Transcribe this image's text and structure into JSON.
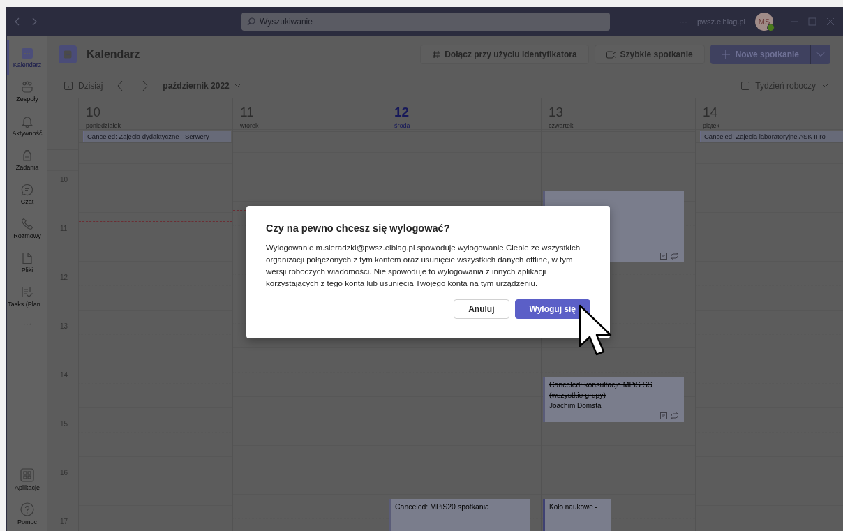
{
  "titlebar": {
    "search": {
      "placeholder": "Wyszukiwanie"
    },
    "more": "···",
    "org": "pwsz.elblag.pl",
    "avatar": {
      "initials": "MS"
    }
  },
  "sidebar": {
    "items": [
      {
        "label": "Kalendarz",
        "selected": true
      },
      {
        "label": "Zespoły",
        "selected": false
      },
      {
        "label": "Aktywność",
        "selected": false
      },
      {
        "label": "Zadania",
        "selected": false
      },
      {
        "label": "Czat",
        "selected": false
      },
      {
        "label": "Rozmowy",
        "selected": false
      },
      {
        "label": "Pliki",
        "selected": false
      },
      {
        "label": "Tasks (Plan…",
        "selected": false
      }
    ],
    "more": "···",
    "bottom_items": [
      {
        "label": "Aplikacje",
        "selected": false
      },
      {
        "label": "Pomoc",
        "selected": false
      }
    ]
  },
  "header": {
    "title": "Kalendarz",
    "buttons": [
      {
        "kind": "join",
        "label": "Dołącz przy użyciu identyfikatora"
      },
      {
        "kind": "meet",
        "label": "Szybkie spotkanie"
      },
      {
        "kind": "new",
        "label": "Nowe spotkanie"
      }
    ]
  },
  "toolbar": {
    "today": "Dzisiaj",
    "month": "październik 2022",
    "view": "Tydzień roboczy"
  },
  "calendar": {
    "hours": [
      "10",
      "11",
      "12",
      "13",
      "14",
      "15",
      "16",
      "17"
    ],
    "days": [
      {
        "number": "10",
        "name": "poniedziałek",
        "today": false,
        "all_day": [
          {
            "title": "Canceled: Zajęcia dydaktyczne - Serwery",
            "canceled": true
          }
        ]
      },
      {
        "number": "11",
        "name": "wtorek",
        "today": false
      },
      {
        "number": "12",
        "name": "środa",
        "today": true,
        "events": [
          {
            "title": "Canceled: MPiS20 spotkania",
            "canceled": true
          }
        ]
      },
      {
        "number": "13",
        "name": "czwartek",
        "today": false,
        "events": [
          {
            "has_notes": true,
            "recurring": true
          },
          {
            "title": "Canceled: konsultacje MPiS SS (wszystkie grupy)",
            "organizer": "Joachim Domsta",
            "canceled": true,
            "has_notes": true,
            "recurring": true
          },
          {
            "title": "Koło naukowe -",
            "canceled": false
          }
        ]
      },
      {
        "number": "14",
        "name": "piątek",
        "today": false,
        "all_day": [
          {
            "title": "Canceled: Zajecia laboratoryjne ASK II ro",
            "canceled": true
          }
        ]
      }
    ]
  },
  "dialog": {
    "title": "Czy na pewno chcesz się wylogować?",
    "body": "Wylogowanie m.sieradzki@pwsz.elblag.pl spowoduje wylogowanie Ciebie ze wszystkich organizacji połączonych z tym kontem oraz usunięcie wszystkich danych offline, w tym wersji roboczych wiadomości. Nie spowoduje to wylogowania z innych aplikacji korzystających z tego konta lub usunięcia Twojego konta na tym urządzeniu.",
    "buttons": [
      {
        "label": "Anuluj",
        "primary": false
      },
      {
        "label": "Wyloguj się",
        "primary": true
      }
    ]
  }
}
